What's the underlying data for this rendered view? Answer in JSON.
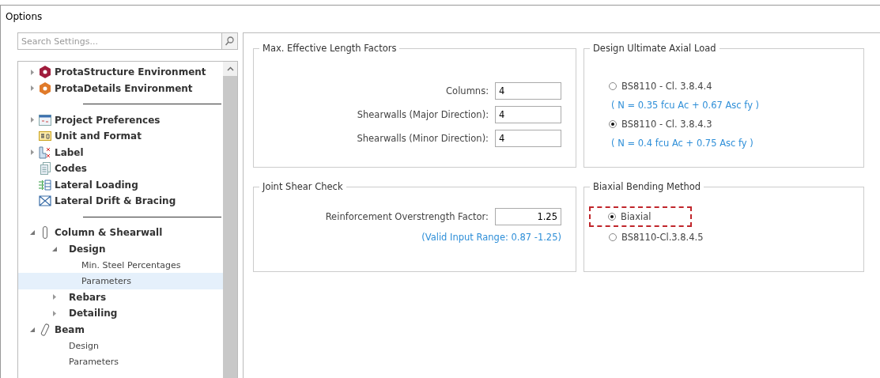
{
  "window": {
    "title": "Options"
  },
  "search": {
    "placeholder": "Search Settings..."
  },
  "tree": [
    {
      "label": "ProtaStructure Environment",
      "expanded": false,
      "selected": false
    },
    {
      "label": "ProtaDetails Environment",
      "expanded": false,
      "selected": false
    },
    {
      "kind": "separator"
    },
    {
      "label": "Project Preferences",
      "expanded": false,
      "selected": false
    },
    {
      "label": "Unit and Format",
      "selected": false
    },
    {
      "label": "Label",
      "expanded": false,
      "selected": false
    },
    {
      "label": "Codes",
      "selected": false
    },
    {
      "label": "Lateral Loading",
      "selected": false
    },
    {
      "label": "Lateral Drift & Bracing",
      "selected": false
    },
    {
      "kind": "separator"
    },
    {
      "label": "Column & Shearwall",
      "expanded": true,
      "selected": false,
      "children": [
        {
          "label": "Design",
          "expanded": true,
          "selected": false,
          "children": [
            {
              "label": "Min. Steel Percentages",
              "selected": false
            },
            {
              "label": "Parameters",
              "selected": true
            }
          ]
        },
        {
          "label": "Rebars",
          "expanded": false,
          "selected": false
        },
        {
          "label": "Detailing",
          "expanded": false,
          "selected": false
        }
      ]
    },
    {
      "label": "Beam",
      "expanded": true,
      "selected": false,
      "children": [
        {
          "label": "Design",
          "selected": false
        },
        {
          "label": "Parameters",
          "selected": false
        }
      ]
    }
  ],
  "groups": [
    {
      "title": "Max. Effective Length Factors",
      "kind": "fields",
      "fields": [
        {
          "label": "Columns:",
          "value": "4"
        },
        {
          "label": "Shearwalls (Major Direction):",
          "value": "4"
        },
        {
          "label": "Shearwalls (Minor Direction):",
          "value": "4"
        }
      ]
    },
    {
      "title": "Design Ultimate Axial Load",
      "kind": "options",
      "options": [
        {
          "label": "BS8110 - Cl. 3.8.4.4",
          "selected": false,
          "formula": "( N = 0.35 fcu Ac + 0.67 Asc fy )"
        },
        {
          "label": "BS8110 - Cl. 3.8.4.3",
          "selected": true,
          "formula": "( N = 0.4 fcu Ac + 0.75 Asc fy )"
        }
      ]
    },
    {
      "title": "Joint Shear Check",
      "kind": "fields",
      "fields": [
        {
          "label": "Reinforcement Overstrength Factor:",
          "value": "1.25",
          "kind": "number",
          "note": "(Valid Input Range: 0.87 -1.25)"
        }
      ]
    },
    {
      "title": "Biaxial Bending Method",
      "kind": "options",
      "options": [
        {
          "label": "Biaxial",
          "selected": true,
          "highlighted": true
        },
        {
          "label": "BS8110-Cl.3.8.4.5",
          "selected": false,
          "highlighted": false
        }
      ]
    }
  ]
}
